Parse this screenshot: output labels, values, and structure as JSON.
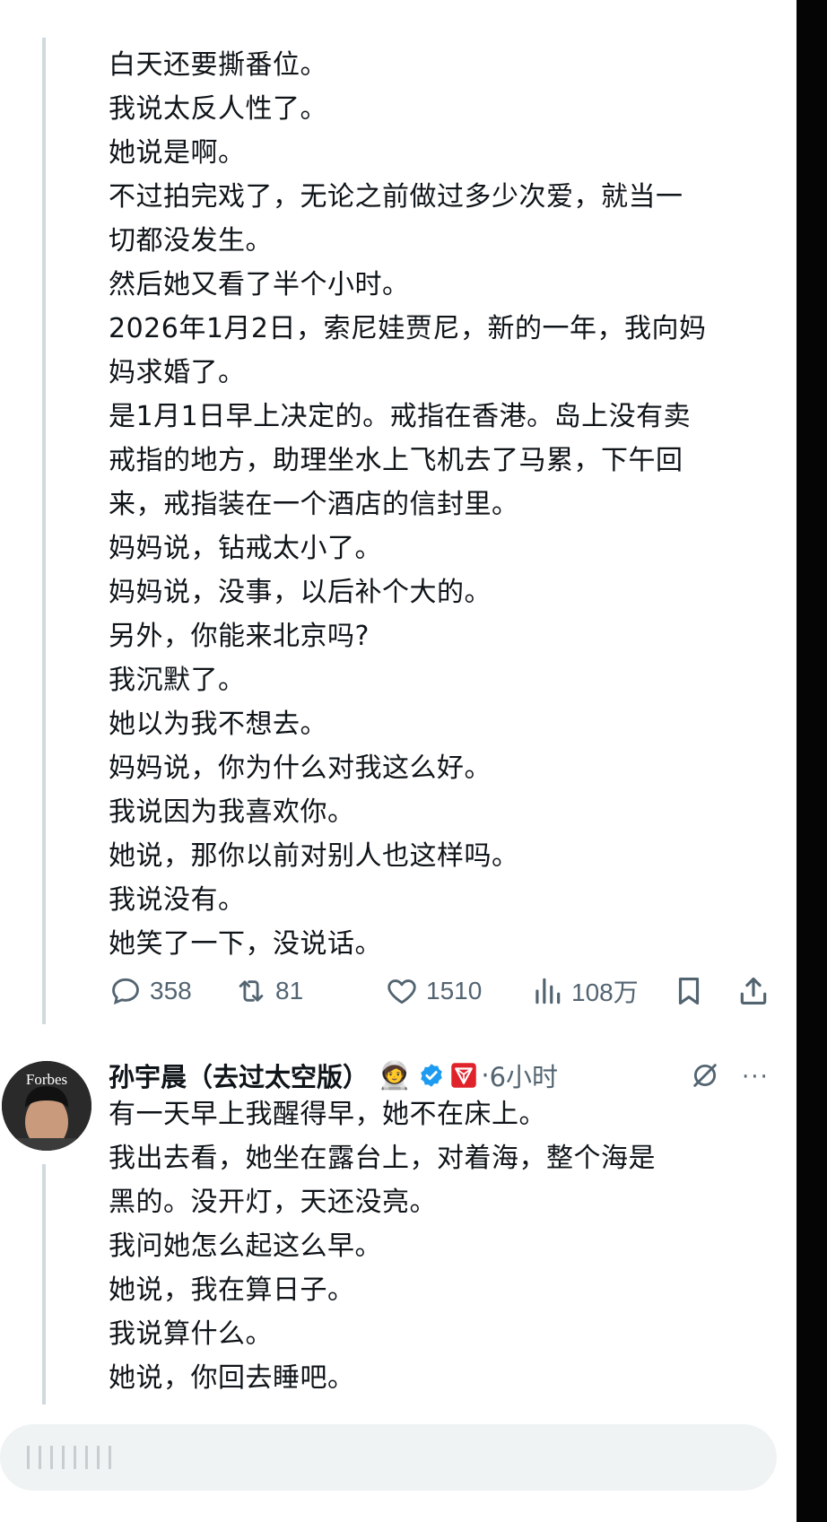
{
  "post1": {
    "lines": [
      "白天还要撕番位。",
      "我说太反人性了。",
      "她说是啊。",
      "不过拍完戏了，无论之前做过多少次爱，就当一",
      "切都没发生。",
      "然后她又看了半个小时。",
      "2026年1月2日，索尼娃贾尼，新的一年，我向妈",
      "妈求婚了。",
      "是1月1日早上决定的。戒指在香港。岛上没有卖",
      "戒指的地方，助理坐水上飞机去了马累，下午回",
      "来，戒指装在一个酒店的信封里。",
      "妈妈说，钻戒太小了。",
      "妈妈说，没事，以后补个大的。",
      "另外，你能来北京吗?",
      "我沉默了。",
      "她以为我不想去。",
      "妈妈说，你为什么对我这么好。",
      "我说因为我喜欢你。",
      "她说，那你以前对别人也这样吗。",
      "我说没有。",
      "她笑了一下，没说话。"
    ],
    "actions": {
      "replies": "358",
      "reposts": "81",
      "likes": "1510",
      "views": "108万"
    },
    "icons": [
      "reply-icon",
      "repost-icon",
      "like-icon",
      "views-icon",
      "bookmark-icon",
      "share-icon"
    ]
  },
  "post2": {
    "avatar_text": "Forbes",
    "author_name": "孙宇晨（去过太空版）",
    "emoji": "🧑‍🚀",
    "separator": "·",
    "time": "6小时",
    "more": "···",
    "lines": [
      "有一天早上我醒得早，她不在床上。",
      "我出去看，她坐在露台上，对着海，整个海是",
      "黑的。没开灯，天还没亮。",
      "我问她怎么起这么早。",
      "她说，我在算日子。",
      "我说算什么。",
      "她说，你回去睡吧。"
    ]
  },
  "reply_bar": {
    "placeholder": " "
  },
  "colors": {
    "text": "#0f1419",
    "secondary": "#536471",
    "thread_line": "#cfd9de",
    "verified": "#1d9bf0",
    "affiliate": "#e0232b",
    "reply_bg": "#eff3f4"
  }
}
